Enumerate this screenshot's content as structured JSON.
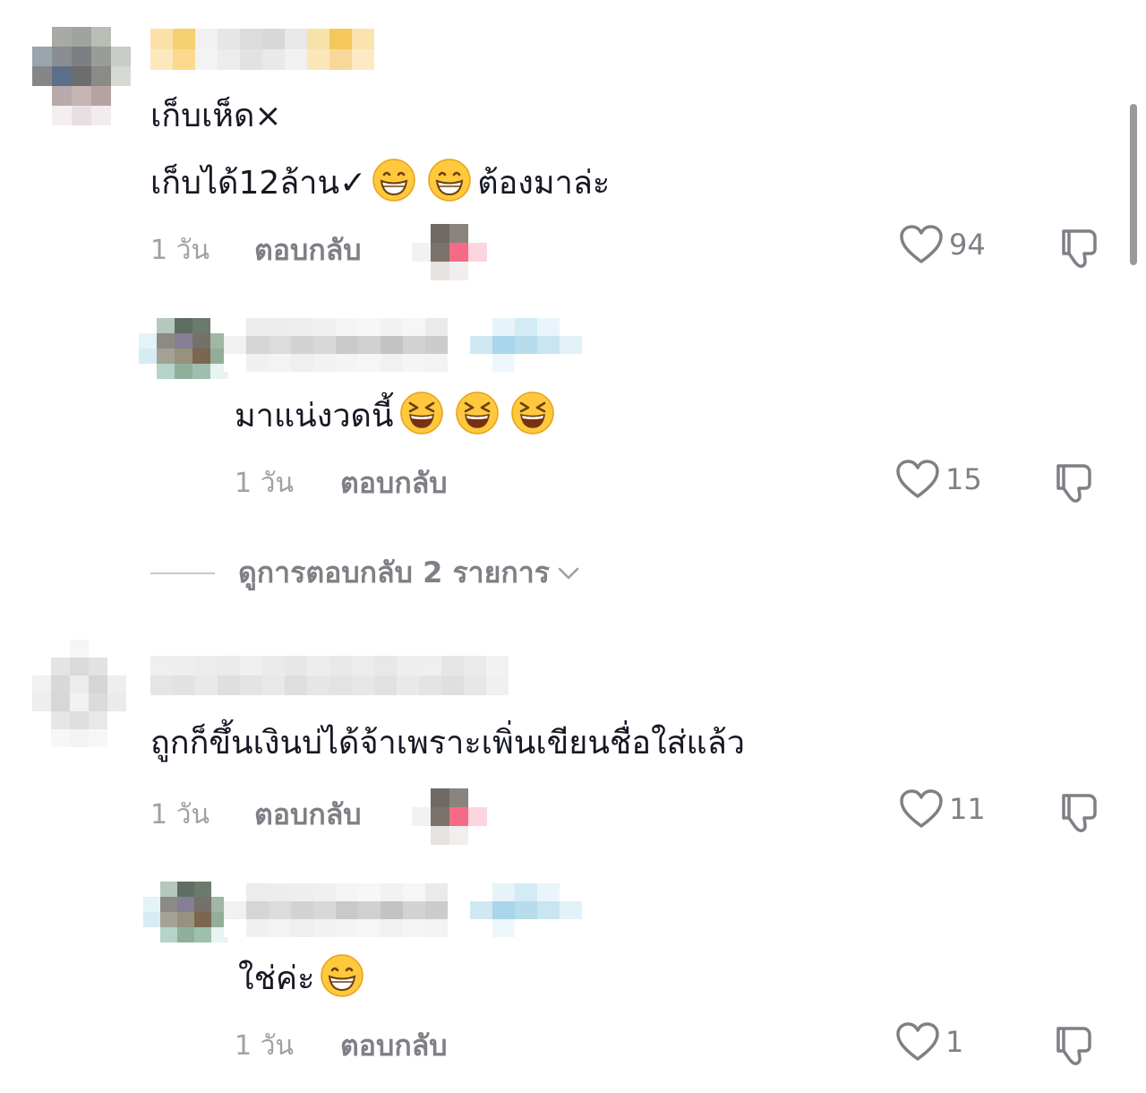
{
  "comments": [
    {
      "text_line1": "เก็บเห็ด×",
      "text_line2_prefix": "เก็บได้12ล้าน✓",
      "text_line2_suffix": "ต้องมาล่ะ",
      "line2_emojis": [
        "grinning-face",
        "grinning-face"
      ],
      "time": "1 วัน",
      "reply_label": "ตอบกลับ",
      "likes": "94"
    },
    {
      "text": "มาแน่งวดนี้",
      "emojis": [
        "laughing-face",
        "laughing-face",
        "laughing-face"
      ],
      "time": "1 วัน",
      "reply_label": "ตอบกลับ",
      "likes": "15"
    },
    {
      "text": "ถูกก็ขึ้นเงินบ่ได้จ้าเพราะเพิ่นเขียนชื่อใส่แล้ว",
      "time": "1 วัน",
      "reply_label": "ตอบกลับ",
      "likes": "11"
    },
    {
      "text": "ใช่ค่ะ",
      "emojis": [
        "grinning-face"
      ],
      "time": "1 วัน",
      "reply_label": "ตอบกลับ",
      "likes": "1"
    }
  ],
  "view_replies_label": "ดูการตอบกลับ 2 รายการ",
  "icons": {
    "like": "heart-outline-icon",
    "dislike": "thumbs-down-icon",
    "expand": "chevron-down-icon"
  },
  "colors": {
    "text": "#161823",
    "meta": "#a0a0a6",
    "secondary": "#7f7f86",
    "emoji_face": "#ffc83d"
  }
}
